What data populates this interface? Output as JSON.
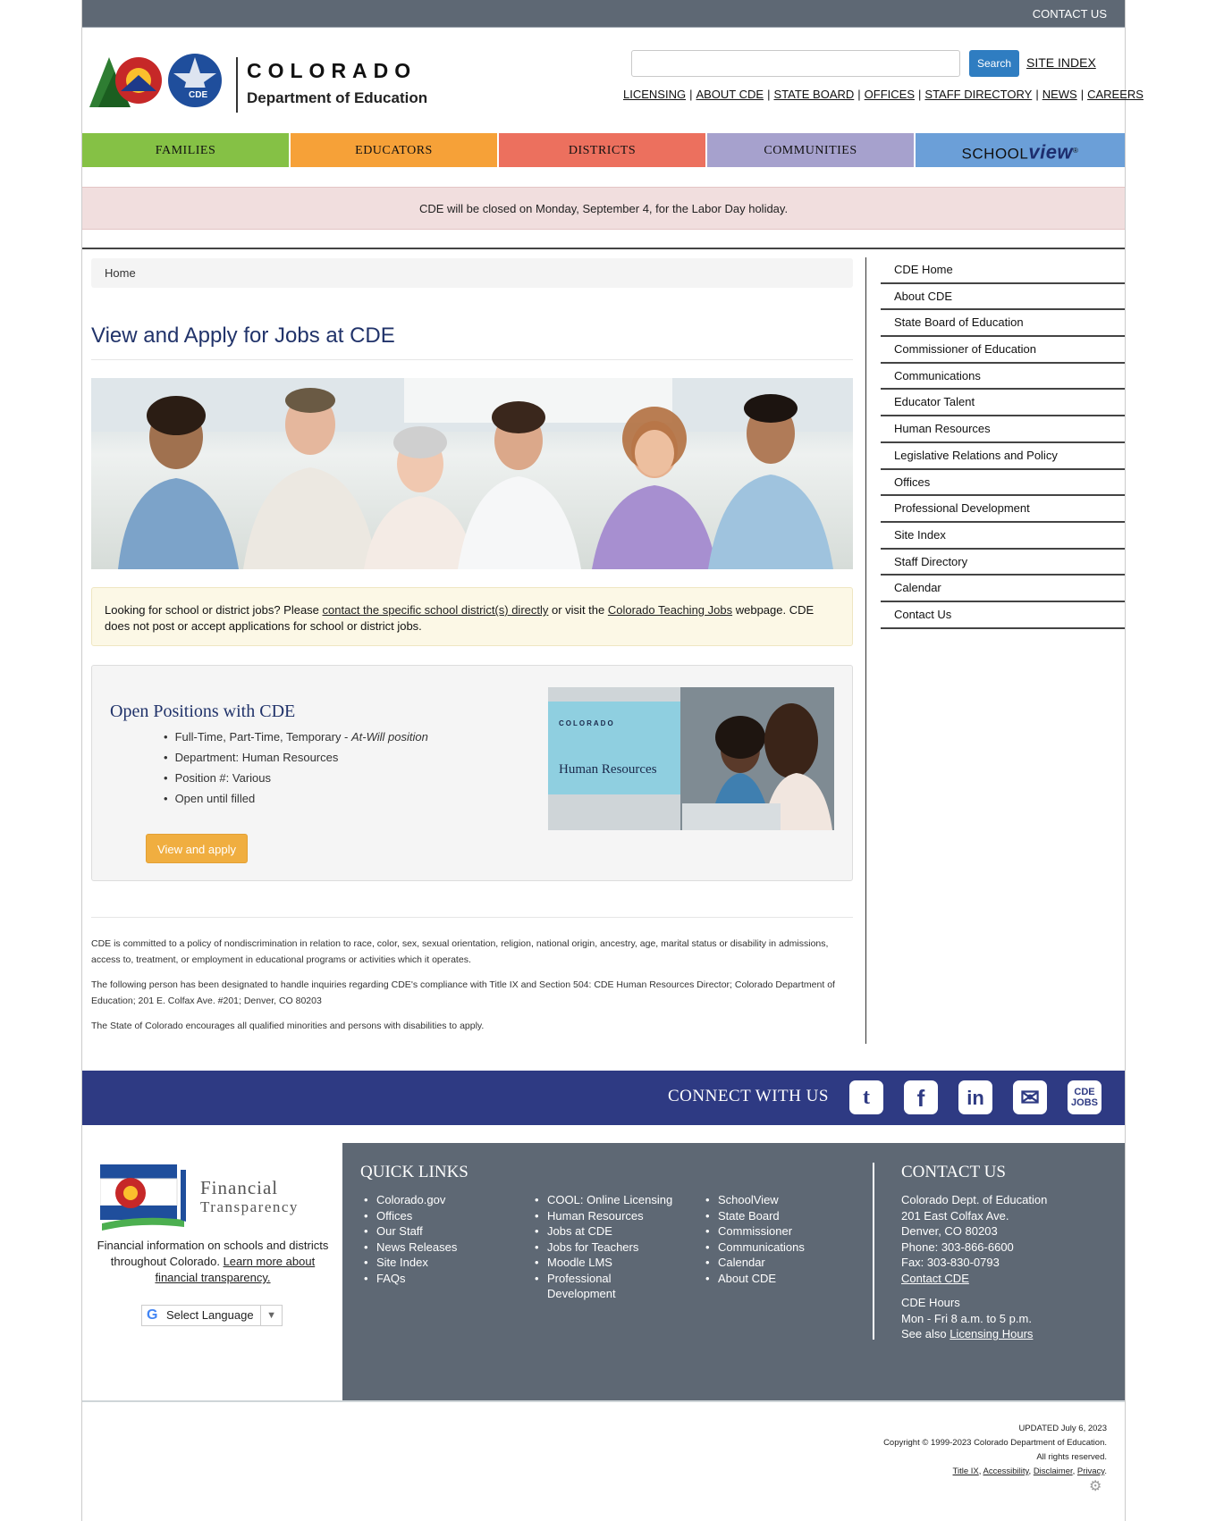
{
  "topbar": {
    "contact_us": "CONTACT US"
  },
  "header": {
    "logo_line1": "COLORADO",
    "logo_line2": "Department of Education",
    "logo_badge": "CDE",
    "search_button": "Search",
    "site_index": "SITE INDEX",
    "top_links": [
      "LICENSING",
      "ABOUT CDE",
      "STATE BOARD",
      "OFFICES",
      "STAFF DIRECTORY",
      "NEWS",
      "CAREERS"
    ]
  },
  "main_nav": {
    "families": "FAMILIES",
    "educators": "EDUCATORS",
    "districts": "DISTRICTS",
    "communities": "COMMUNITIES",
    "schoolview_a": "SCHOOL",
    "schoolview_b": "view",
    "schoolview_reg": "®"
  },
  "alert": "CDE will be closed on Monday, September 4, for the Labor Day holiday.",
  "breadcrumb": "Home",
  "page_title": "View and Apply for Jobs at CDE",
  "info_box": {
    "text1": "Looking for school or district jobs? Please ",
    "link1": "contact the specific school district(s) directly",
    "text2": " or visit the ",
    "link2": "Colorado Teaching Jobs",
    "text3": " webpage. CDE does not post or accept applications for school or district jobs."
  },
  "job": {
    "title": "Open Positions with CDE",
    "item1_a": "Full-Time, Part-Time, Temporary - ",
    "item1_b": "At-Will position",
    "item2": "Department: Human Resources",
    "item3": "Position #: Various",
    "item4": "Open until filled",
    "apply_button": "View and apply",
    "image_brand": "COLORADO",
    "image_label": "Human Resources"
  },
  "fine_print": [
    "CDE is committed to a policy of nondiscrimination in relation to race, color, sex, sexual orientation, religion, national origin, ancestry, age, marital status or disability in admissions, access to, treatment, or employment in educational programs or activities which it operates.",
    "The following person has been designated to handle inquiries regarding CDE's compliance with Title IX and Section 504: CDE Human Resources Director; Colorado Department of Education; 201 E. Colfax Ave. #201; Denver, CO 80203",
    "The State of Colorado encourages all qualified minorities and persons with disabilities to apply."
  ],
  "sidebar": [
    "CDE Home",
    "About CDE",
    "State Board of Education",
    "Commissioner of Education",
    "Communications",
    "Educator Talent",
    "Human Resources",
    "Legislative Relations and Policy",
    "Offices",
    "Professional Development",
    "Site Index",
    "Staff Directory",
    "Calendar",
    "Contact Us"
  ],
  "connect": {
    "label": "CONNECT WITH US",
    "twitter": "t",
    "facebook": "f",
    "linkedin": "in",
    "email": "✉",
    "jobs_a": "CDE",
    "jobs_b": "JOBS"
  },
  "footer": {
    "ft_title1": "Financial",
    "ft_title2": "Transparency",
    "ft_desc": "Financial information on schools and districts throughout Colorado. ",
    "ft_link": "Learn more about financial transparency.",
    "translate": "Select Language",
    "translate_g": "G",
    "translate_arrow": "▼",
    "quick_links_title": "QUICK LINKS",
    "ql_col1": [
      "Colorado.gov",
      "Offices",
      "Our Staff",
      "News Releases",
      "Site Index",
      "FAQs"
    ],
    "ql_col2": [
      "COOL: Online Licensing",
      "Human Resources",
      "Jobs at CDE",
      "Jobs for Teachers",
      "Moodle LMS",
      "Professional Development"
    ],
    "ql_col3": [
      "SchoolView",
      "State Board",
      "Commissioner",
      "Communications",
      "Calendar",
      "About CDE"
    ],
    "contact_title": "CONTACT US",
    "contact_lines": [
      "Colorado Dept. of Education",
      "201 East Colfax Ave.",
      "Denver, CO 80203",
      "Phone: 303-866-6600",
      "Fax: 303-830-0793"
    ],
    "contact_link": "Contact CDE",
    "hours_title": "CDE Hours",
    "hours": "Mon - Fri 8 a.m. to 5 p.m.",
    "see_also": "See also ",
    "licensing_hours": "Licensing Hours",
    "updated": "UPDATED July 6, 2023",
    "copyright": "Copyright © 1999-2023 Colorado Department of Education.",
    "rights": "All rights reserved.",
    "legal": [
      "Title IX",
      "Accessibility",
      "Disclaimer",
      "Privacy"
    ]
  }
}
